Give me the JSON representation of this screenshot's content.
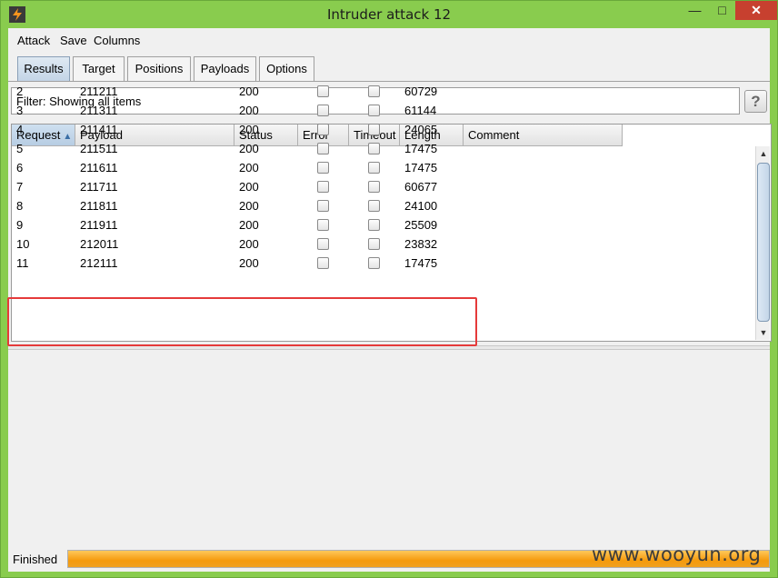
{
  "window": {
    "title": "Intruder attack 12",
    "minimize_glyph": "—",
    "maximize_glyph": "□",
    "close_glyph": "✕"
  },
  "menu": [
    "Attack",
    "Save",
    "Columns"
  ],
  "tabs": [
    "Results",
    "Target",
    "Positions",
    "Payloads",
    "Options"
  ],
  "active_tab": "Results",
  "filter": {
    "text": "Filter: Showing all items"
  },
  "help_label": "?",
  "table": {
    "columns": [
      "Request",
      "Payload",
      "Status",
      "Error",
      "Timeout",
      "Length",
      "Comment"
    ],
    "sorted_column": "Request",
    "rows": [
      {
        "request": "2",
        "payload": "211211",
        "status": "200",
        "error": false,
        "timeout": false,
        "length": "60729"
      },
      {
        "request": "3",
        "payload": "211311",
        "status": "200",
        "error": false,
        "timeout": false,
        "length": "61144"
      },
      {
        "request": "4",
        "payload": "211411",
        "status": "200",
        "error": false,
        "timeout": false,
        "length": "24065"
      },
      {
        "request": "5",
        "payload": "211511",
        "status": "200",
        "error": false,
        "timeout": false,
        "length": "17475"
      },
      {
        "request": "6",
        "payload": "211611",
        "status": "200",
        "error": false,
        "timeout": false,
        "length": "17475"
      },
      {
        "request": "7",
        "payload": "211711",
        "status": "200",
        "error": false,
        "timeout": false,
        "length": "60677"
      },
      {
        "request": "8",
        "payload": "211811",
        "status": "200",
        "error": false,
        "timeout": false,
        "length": "24100"
      },
      {
        "request": "9",
        "payload": "211911",
        "status": "200",
        "error": false,
        "timeout": false,
        "length": "25509"
      },
      {
        "request": "10",
        "payload": "212011",
        "status": "200",
        "error": false,
        "timeout": false,
        "length": "23832"
      },
      {
        "request": "11",
        "payload": "212111",
        "status": "200",
        "error": false,
        "timeout": false,
        "length": "17475"
      }
    ]
  },
  "status": {
    "label": "Finished",
    "progress": 1.0
  },
  "watermark": "www.wooyun.org",
  "colors": {
    "highlight": "#e53a3a",
    "progress": "#f59a0c",
    "title_bar": "#89cc4e"
  }
}
